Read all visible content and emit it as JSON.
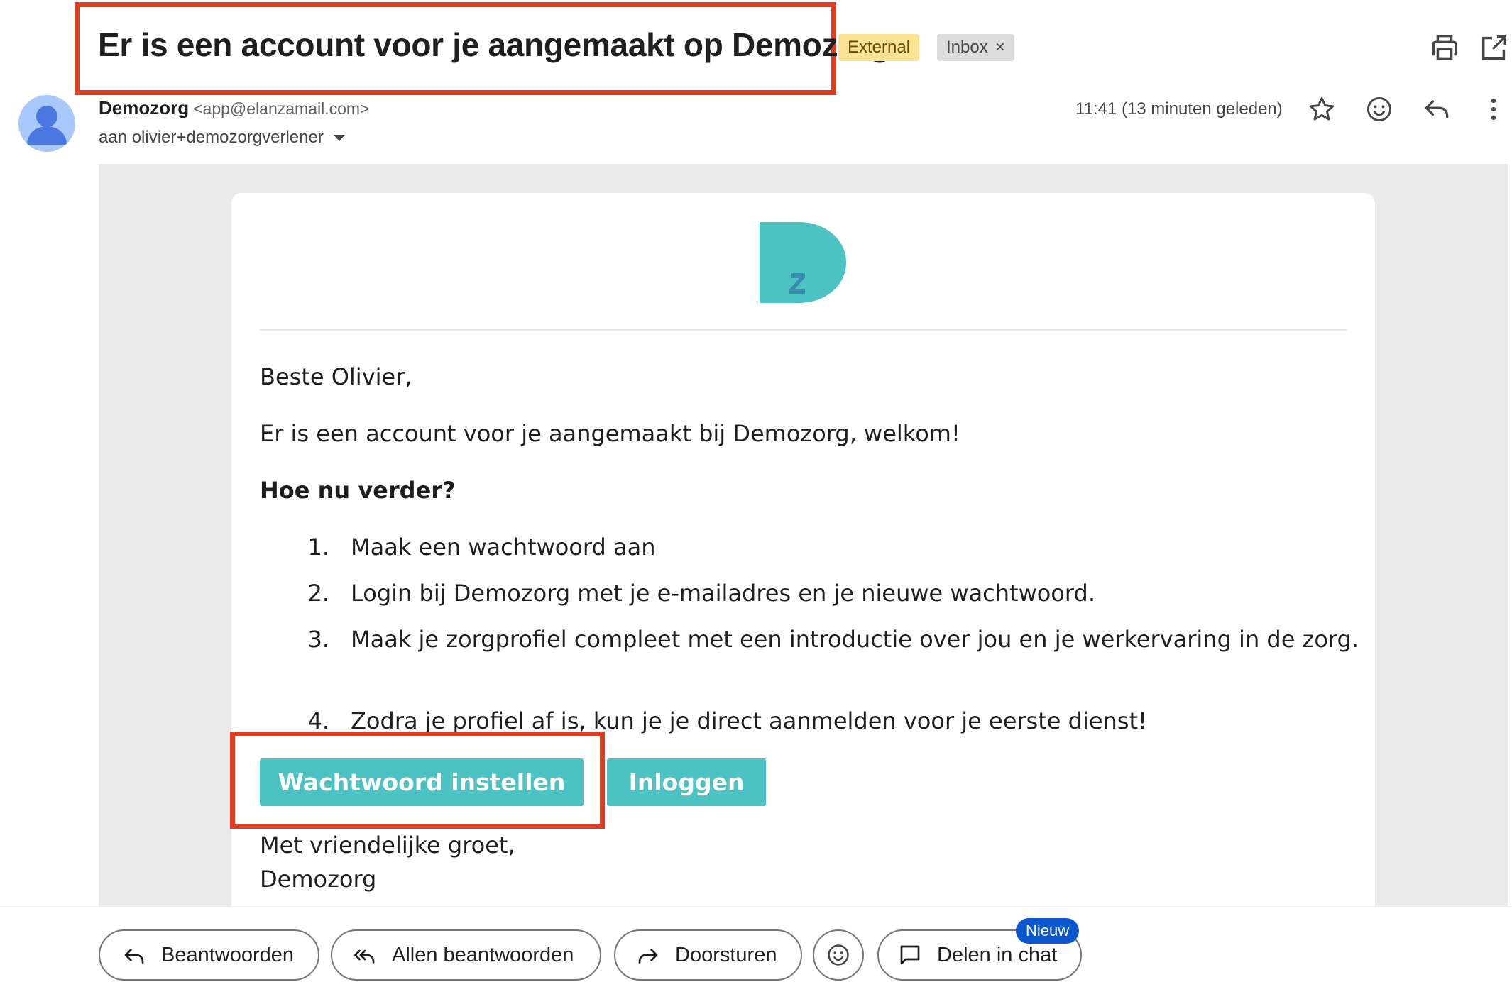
{
  "header": {
    "subject": "Er is een account voor je aangemaakt op Demozorg",
    "labels": [
      {
        "text": "External",
        "color": "#fde293"
      },
      {
        "text": "Inbox",
        "remove": "×",
        "color": "#dddddd"
      }
    ],
    "icons": {
      "print": "print-icon",
      "open_new": "open-in-new-window-icon"
    }
  },
  "message_meta": {
    "sender_name": "Demozorg",
    "sender_email": "<app@elanzamail.com>",
    "recipient": "aan olivier+demozorgverlener",
    "time": "11:41 (13 minuten geleden)",
    "icons": [
      "star-icon",
      "emoji-reaction-icon",
      "reply-icon",
      "more-vert-icon"
    ]
  },
  "email": {
    "logo": "Demozorg logo",
    "greeting": "Beste Olivier,",
    "intro": "Er is een account voor je aangemaakt bij Demozorg, welkom!",
    "heading": "Hoe nu verder?",
    "steps": [
      {
        "num": "1.",
        "text": "Maak een wachtwoord aan"
      },
      {
        "num": "2.",
        "text": "Login bij Demozorg met je e-mailadres en je nieuwe wachtwoord."
      },
      {
        "num": "3.",
        "text": "Maak je zorgprofiel compleet met een introductie over jou en je werkervaring in de zorg."
      },
      {
        "num": "4.",
        "text": "Zodra je profiel af is, kun je je direct aanmelden voor je eerste dienst!"
      }
    ],
    "buttons": {
      "set_password": "Wachtwoord instellen",
      "login": "Inloggen"
    },
    "closing": "Met vriendelijke groet,",
    "signature": "Demozorg",
    "accent_color": "#4dc2c3",
    "highlight_color": "#e03c1f"
  },
  "actions": {
    "reply": "Beantwoorden",
    "reply_all": "Allen beantwoorden",
    "forward": "Doorsturen",
    "share_chat": "Delen in chat",
    "new_badge": "Nieuw"
  }
}
